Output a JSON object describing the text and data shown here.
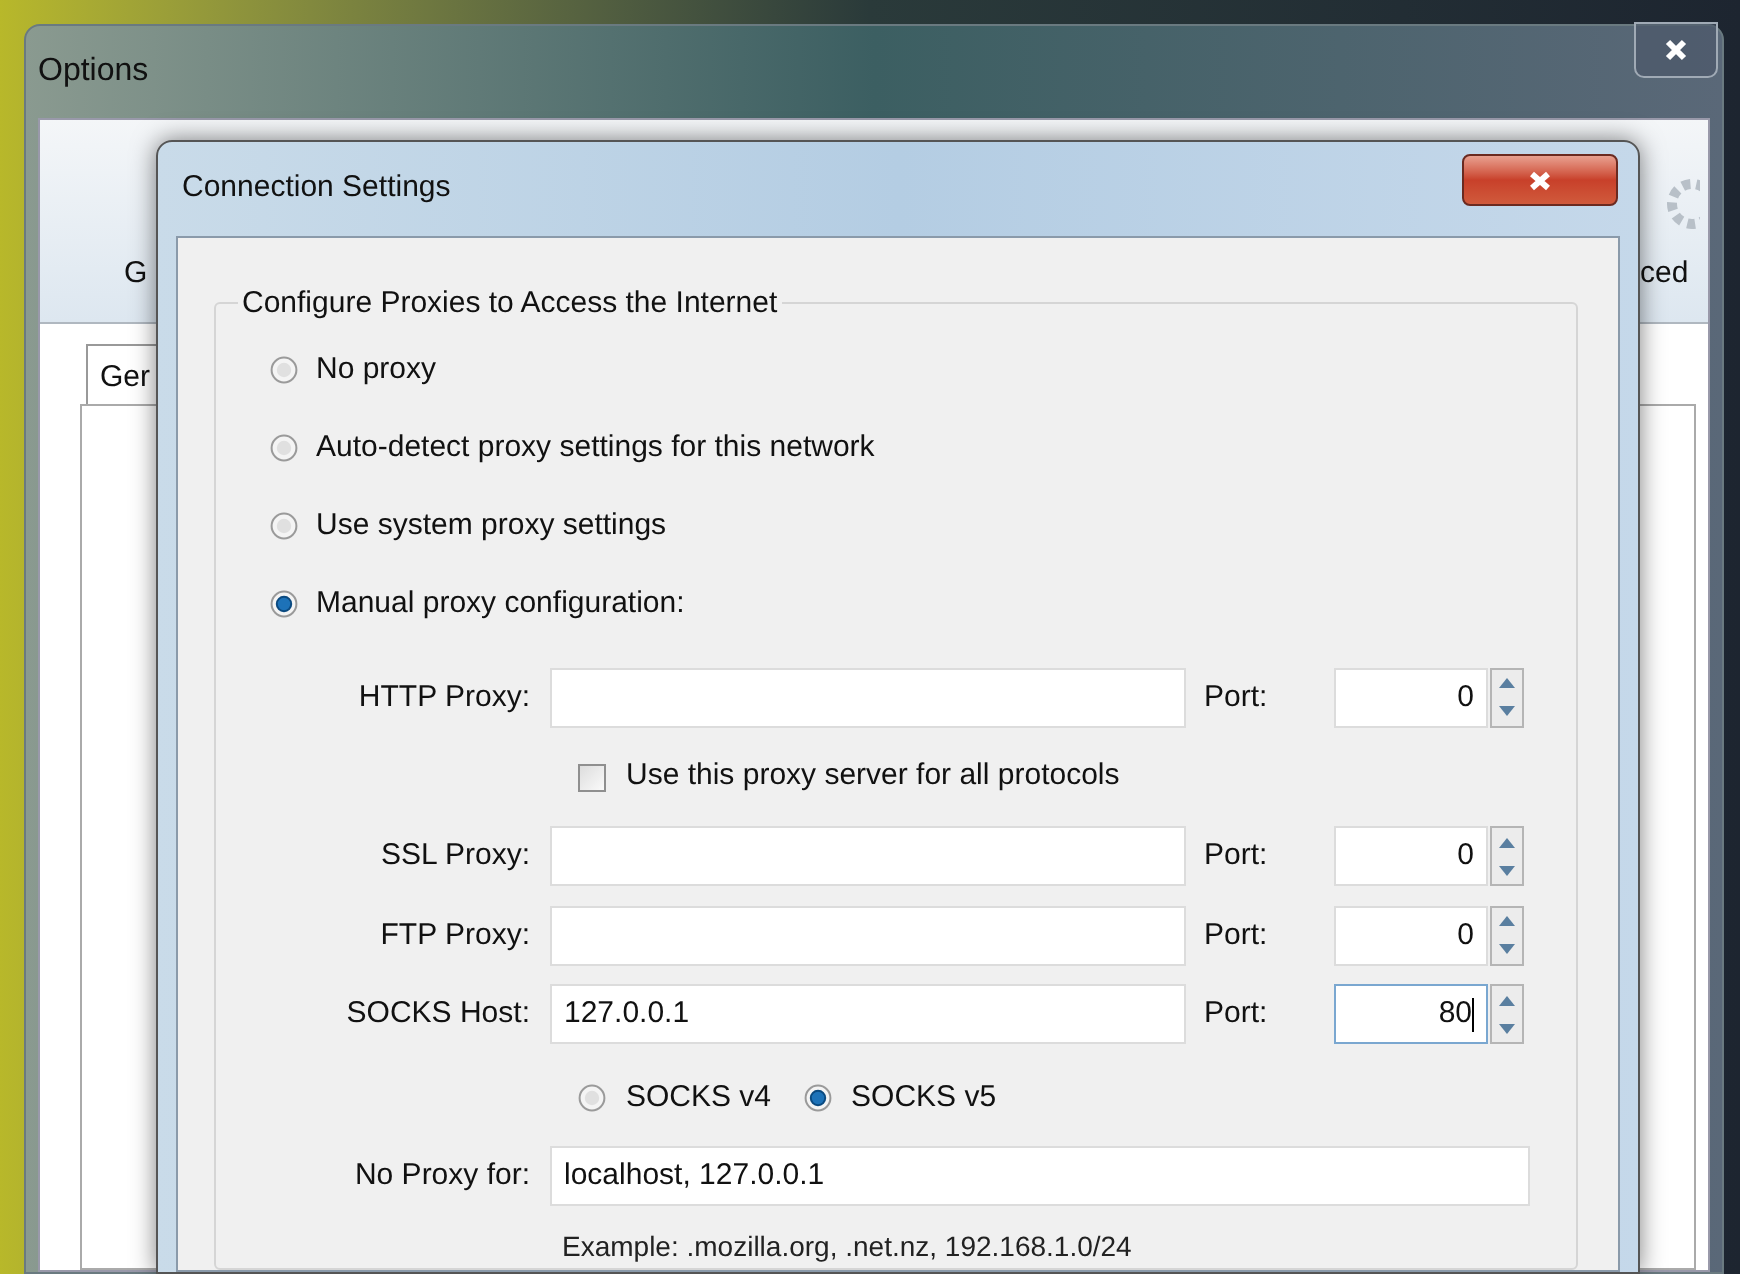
{
  "options_window": {
    "title": "Options",
    "toolbar": [
      {
        "label": "G"
      },
      {
        "label": "ced"
      }
    ],
    "tabs": [
      {
        "label": "Ger"
      }
    ]
  },
  "dialog": {
    "title": "Connection Settings",
    "group_title": "Configure Proxies to Access the Internet",
    "proxy_modes": [
      {
        "label": "No proxy",
        "selected": false
      },
      {
        "label": "Auto-detect proxy settings for this network",
        "selected": false
      },
      {
        "label": "Use system proxy settings",
        "selected": false
      },
      {
        "label": "Manual proxy configuration:",
        "selected": true
      }
    ],
    "proxies": [
      {
        "kind": "host",
        "label": "HTTP Proxy:",
        "port_label": "Port:",
        "port": "0",
        "port_focused": false
      },
      {
        "kind": "checkbox",
        "label": "Use this proxy server for all protocols",
        "checked": false
      },
      {
        "kind": "host",
        "label": "SSL Proxy:",
        "port_label": "Port:",
        "port": "0",
        "port_focused": false
      },
      {
        "kind": "host",
        "label": "FTP Proxy:",
        "port_label": "Port:",
        "port": "0",
        "port_focused": false
      },
      {
        "kind": "host",
        "label": "SOCKS Host:",
        "value": "127.0.0.1",
        "port_label": "Port:",
        "port": "80",
        "port_focused": true
      },
      {
        "kind": "socks_version",
        "options": [
          {
            "label": "SOCKS v4",
            "selected": false
          },
          {
            "label": "SOCKS v5",
            "selected": true
          }
        ]
      }
    ],
    "no_proxy": {
      "label": "No Proxy for:",
      "value": "localhost, 127.0.0.1",
      "example": "Example: .mozilla.org, .net.nz, 192.168.1.0/24"
    }
  }
}
